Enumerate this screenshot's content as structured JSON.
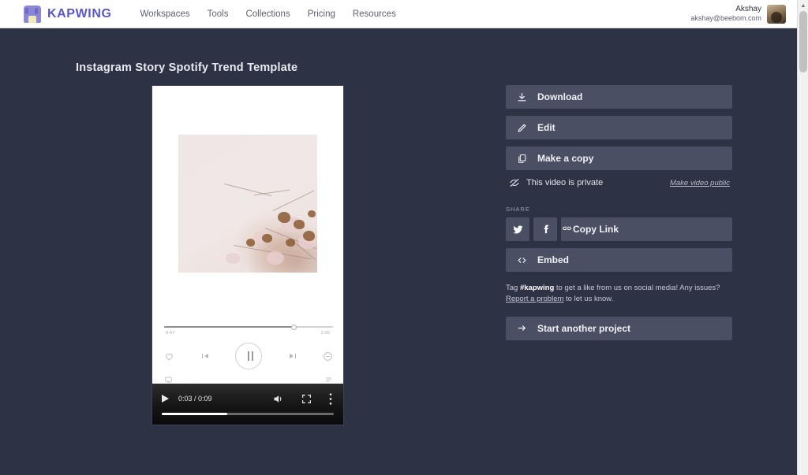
{
  "header": {
    "brand": "KAPWING",
    "nav_items": [
      {
        "label": "Workspaces"
      },
      {
        "label": "Tools"
      },
      {
        "label": "Collections"
      },
      {
        "label": "Pricing"
      },
      {
        "label": "Resources"
      }
    ],
    "user": {
      "name": "Akshay",
      "email": "akshay@beebom.com"
    }
  },
  "page": {
    "title": "Instagram Story Spotify Trend Template"
  },
  "video_preview": {
    "spotify_ui": {
      "current_time": "0:47",
      "total_time": "1:00"
    },
    "player": {
      "time_display": "0:03 / 0:09"
    }
  },
  "actions": {
    "download": "Download",
    "edit": "Edit",
    "make_copy": "Make a copy"
  },
  "privacy": {
    "status": "This video is private",
    "toggle_link": "Make video public"
  },
  "share": {
    "label": "SHARE",
    "copy_link": "Copy Link",
    "embed": "Embed"
  },
  "note": {
    "prefix": "Tag ",
    "tag": "#kapwing",
    "middle": " to get a like from us on social media! Any issues? ",
    "link": "Report a problem",
    "suffix": " to let us know."
  },
  "footer_action": {
    "start_another": "Start another project"
  },
  "colors": {
    "page_bg": "#2e3245",
    "button_bg": "#4b4f63",
    "brand": "#5b57c9"
  }
}
